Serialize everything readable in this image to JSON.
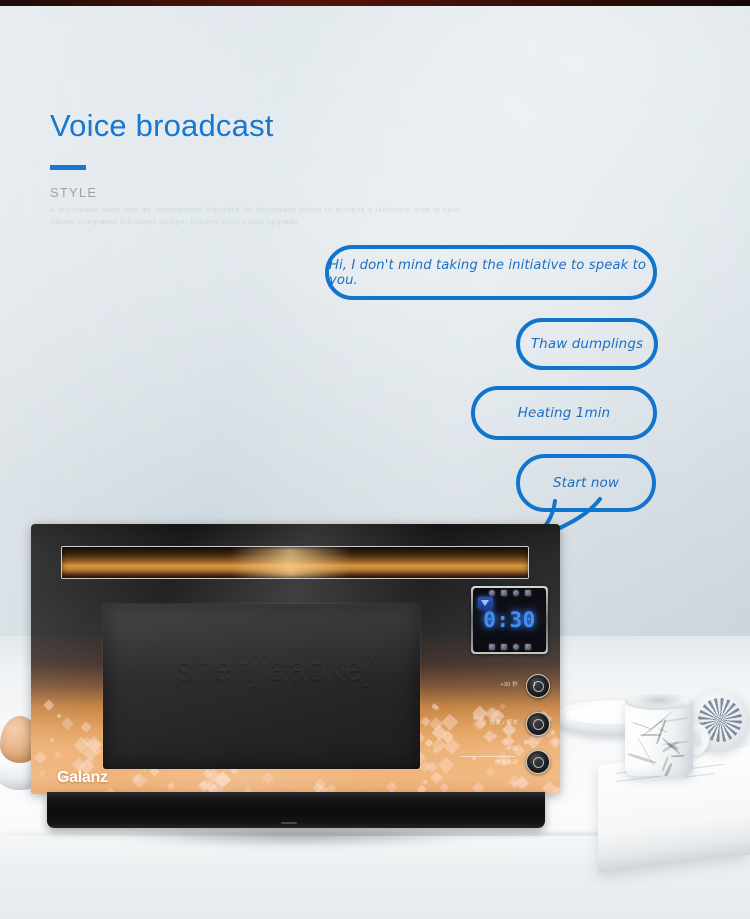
{
  "page": {
    "title": "Voice broadcast",
    "accent_color": "#1777d3",
    "bubble_color": "#1275cd",
    "background_color": "#dfe5e9",
    "top_strip_color": "#3a1008"
  },
  "header": {
    "headline": "Voice broadcast",
    "style_label": "STYLE",
    "description": "A microwave oven with an international standard for microwave ovens to achieve a landmark leap in color values integrated full panel design, kitchen color value upgrade"
  },
  "speech_bubbles": [
    {
      "text": "Hi, I don't mind taking the initiative to speak to you.",
      "has_tail": false
    },
    {
      "text": "Thaw dumplings",
      "has_tail": false
    },
    {
      "text": "Heating 1min",
      "has_tail": false
    },
    {
      "text": "Start now",
      "has_tail": true
    }
  ],
  "product": {
    "brand": "Galanz",
    "watermark": "shenjiaaokeji",
    "display": {
      "time": "0:30",
      "wifi_icon": "wifi-icon",
      "top_icons": [
        "mute-icon",
        "lock-icon",
        "light-icon",
        "fan-icon"
      ],
      "bottom_icons": [
        "menu-icon",
        "timer-icon",
        "power-icon",
        "grill-icon"
      ]
    },
    "controls": [
      {
        "label": "+30 秒",
        "icon": "clock-knob-icon"
      },
      {
        "label": "微波 / 解冻",
        "icon": "dial-knob-icon"
      },
      {
        "label": "快速启动",
        "sub_label": "IPID",
        "icon": "power-knob-icon"
      }
    ]
  },
  "props": {
    "egg": "egg-in-cup",
    "plate": "white-plate",
    "mug": "marble-mug",
    "book": "white-book",
    "saucer": "patterned-saucer"
  }
}
